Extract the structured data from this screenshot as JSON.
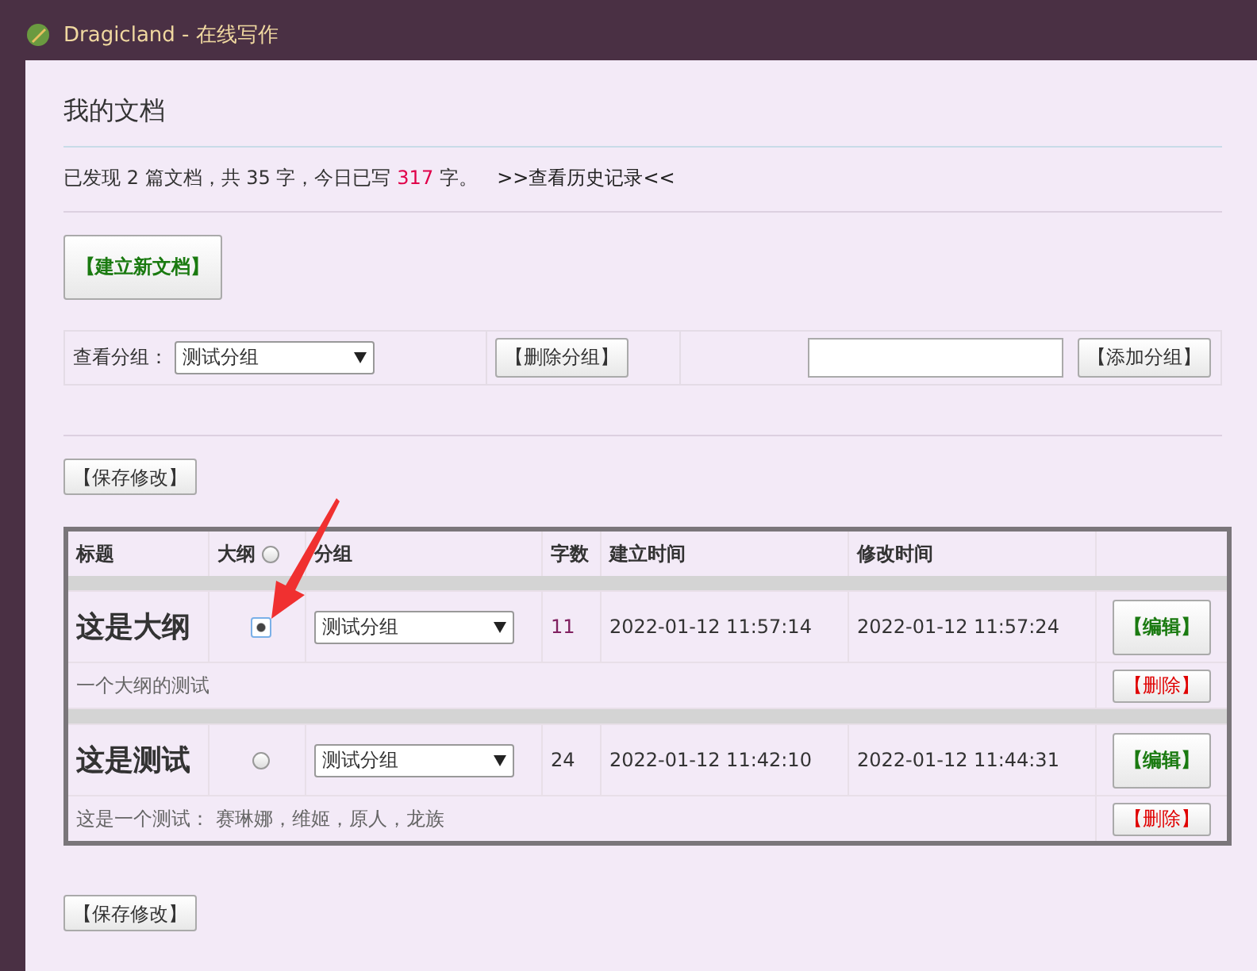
{
  "window": {
    "title": "Dragicland - 在线写作"
  },
  "heading": "我的文档",
  "summary": {
    "before": "已发现 2 篇文档，共 35 字，今日已写",
    "today_count": "317",
    "after": "字。",
    "history_link": ">>查看历史记录<<"
  },
  "new_doc_button": "【建立新文档】",
  "group_bar": {
    "label": "查看分组：",
    "select_value": "测试分组",
    "delete_button": "【删除分组】",
    "add_button": "【添加分组】"
  },
  "save_buttons": [
    "【保存修改】",
    "【保存修改】"
  ],
  "table": {
    "columns": [
      "标题",
      "大纲",
      "分组",
      "字数",
      "建立时间",
      "修改时间"
    ],
    "outline_header_radio": {
      "selected": false
    },
    "rows": [
      {
        "title": "这是大纲",
        "outline_selected": true,
        "group": "测试分组",
        "word_count": "11",
        "created": "2022-01-12 11:57:14",
        "modified": "2022-01-12 11:57:24",
        "description": "一个大纲的测试",
        "edit_button": "【编辑】",
        "delete_button": "【删除】"
      },
      {
        "title": "这是测试",
        "outline_selected": false,
        "group": "测试分组",
        "word_count": "24",
        "created": "2022-01-12 11:42:10",
        "modified": "2022-01-12 11:44:31",
        "description": "这是一个测试： 赛琳娜，维姬，原人，龙族",
        "edit_button": "【编辑】",
        "delete_button": "【删除】"
      }
    ]
  }
}
